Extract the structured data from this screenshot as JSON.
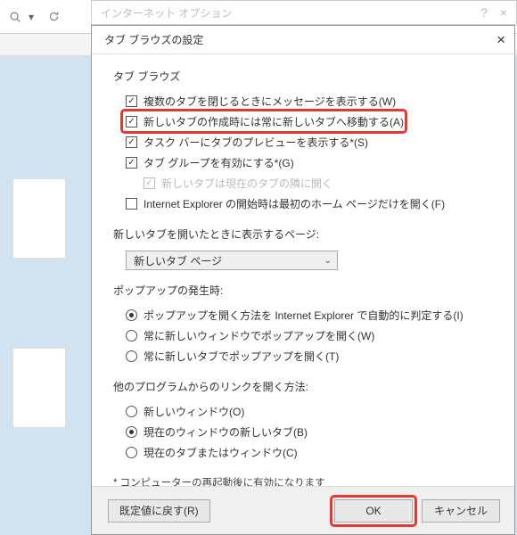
{
  "parentDialog": {
    "title": "インターネット オプション",
    "help": "?",
    "close": "×"
  },
  "dialog": {
    "title": "タブ ブラウズの設定",
    "close": "×"
  },
  "tabBrowse": {
    "header": "タブ ブラウズ",
    "warnClose": "複数のタブを閉じるときにメッセージを表示する(W)",
    "switchNew": "新しいタブの作成時には常に新しいタブへ移動する(A)",
    "taskbarPreview": "タスク バーにタブのプレビューを表示する*(S)",
    "enableGroups": "タブ グループを有効にする*(G)",
    "openNextTo": "新しいタブは現在のタブの隣に開く",
    "homeOnlyFirst": "Internet Explorer の開始時は最初のホーム ページだけを開く(F)"
  },
  "newTab": {
    "header": "新しいタブを開いたときに表示するページ:",
    "selected": "新しいタブ ページ"
  },
  "popup": {
    "header": "ポップアップの発生時:",
    "auto": "ポップアップを開く方法を Internet Explorer で自動的に判定する(I)",
    "newWindow": "常に新しいウィンドウでポップアップを開く(W)",
    "newTab": "常に新しいタブでポップアップを開く(T)"
  },
  "links": {
    "header": "他のプログラムからのリンクを開く方法:",
    "newWindow": "新しいウィンドウ(O)",
    "currentWindowNewTab": "現在のウィンドウの新しいタブ(B)",
    "currentTabOrWindow": "現在のタブまたはウィンドウ(C)"
  },
  "footnote": "* コンピューターの再起動後に有効になります",
  "buttons": {
    "reset": "既定値に戻す(R)",
    "ok": "OK",
    "cancel": "キャンセル"
  }
}
